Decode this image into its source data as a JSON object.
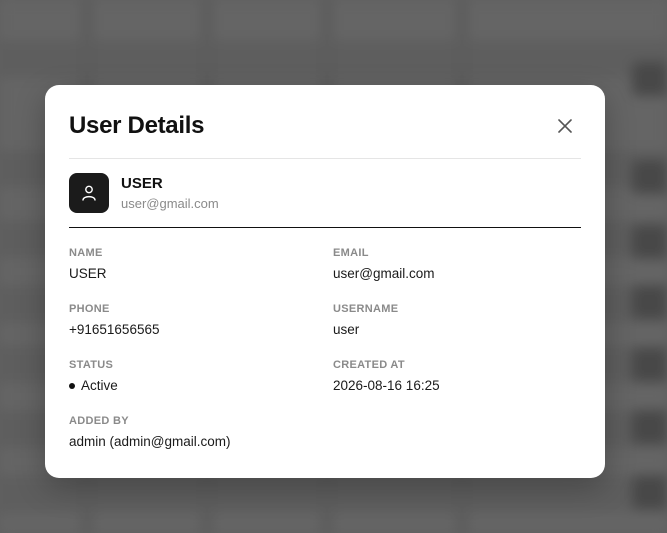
{
  "modal": {
    "title": "User Details",
    "close_icon": "close-icon"
  },
  "user": {
    "avatar_icon": "user-icon",
    "name": "USER",
    "email": "user@gmail.com"
  },
  "fields": {
    "name": {
      "label": "NAME",
      "value": "USER"
    },
    "email": {
      "label": "EMAIL",
      "value": "user@gmail.com"
    },
    "phone": {
      "label": "PHONE",
      "value": "+91651656565"
    },
    "username": {
      "label": "USERNAME",
      "value": "user"
    },
    "status": {
      "label": "STATUS",
      "value": "Active"
    },
    "created_at": {
      "label": "CREATED AT",
      "value": "2026-08-16 16:25"
    },
    "added_by": {
      "label": "ADDED BY",
      "value": "admin (admin@gmail.com)"
    }
  },
  "colors": {
    "overlay": "#6f6f6f",
    "modal_bg": "#ffffff",
    "avatar_bg": "#1b1b1b",
    "label": "#8a8a8a",
    "text": "#1a1a1a"
  }
}
